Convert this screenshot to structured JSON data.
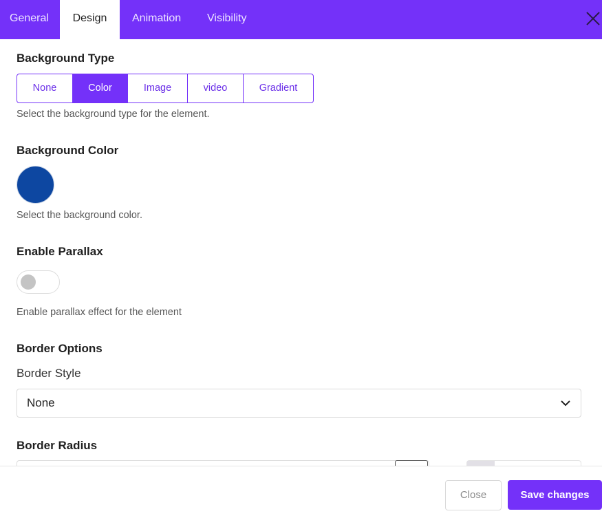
{
  "tabs": [
    {
      "label": "General",
      "active": false
    },
    {
      "label": "Design",
      "active": true
    },
    {
      "label": "Animation",
      "active": false
    },
    {
      "label": "Visibility",
      "active": false
    }
  ],
  "window": {
    "close_icon": "close-icon"
  },
  "background_type": {
    "heading": "Background Type",
    "options": [
      "None",
      "Color",
      "Image",
      "video",
      "Gradient"
    ],
    "selected": "Color",
    "help": "Select the background type for the element."
  },
  "background_color": {
    "heading": "Background Color",
    "value": "#0d47a1",
    "help": "Select the background color."
  },
  "parallax": {
    "heading": "Enable Parallax",
    "enabled": false,
    "help": "Enable parallax effect for the element"
  },
  "border": {
    "heading": "Border Options",
    "style_label": "Border Style",
    "style_value": "None"
  },
  "border_radius": {
    "heading": "Border Radius"
  },
  "footer": {
    "close_label": "Close",
    "save_label": "Save changes"
  },
  "colors": {
    "accent": "#7431f9",
    "swatch": "#0d47a1"
  }
}
